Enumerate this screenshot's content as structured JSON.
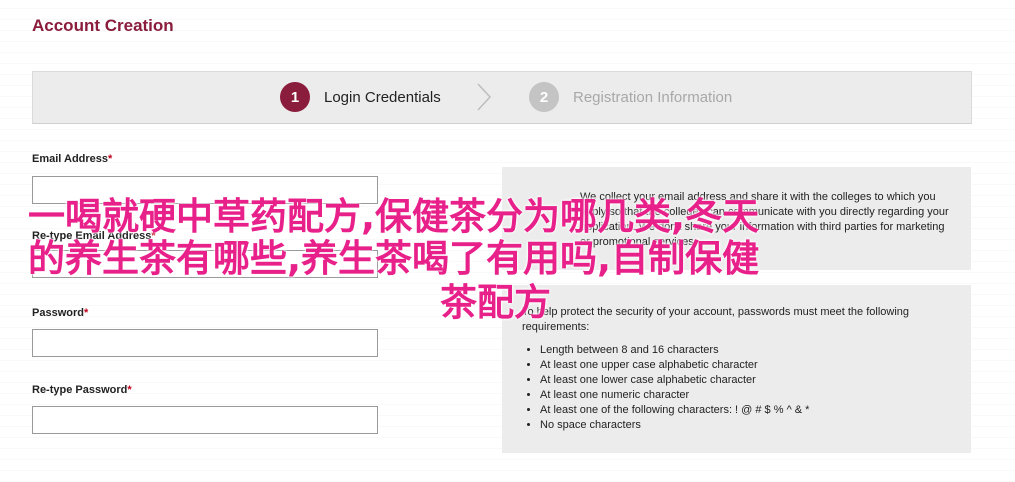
{
  "page": {
    "title": "Account Creation"
  },
  "steps": [
    {
      "number": "1",
      "label": "Login Credentials",
      "state": "active"
    },
    {
      "number": "2",
      "label": "Registration Information",
      "state": "inactive"
    }
  ],
  "form": {
    "email_label": "Email Address",
    "retype_email_label": "Re-type Email Address",
    "password_label": "Password",
    "retype_password_label": "Re-type Password",
    "required_mark": "*"
  },
  "info": {
    "email_note": "We collect your email address and share it with the colleges to which you apply so that the colleges can communicate with you directly regarding your application. We don't share your information with third parties for marketing or promotional services.",
    "password_intro": "To help protect the security of your account, passwords must meet the following requirements:",
    "password_rules": [
      "Length between 8 and 16 characters",
      "At least one upper case alphabetic character",
      "At least one lower case alphabetic character",
      "At least one numeric character",
      "At least one of the following characters: ! @ # $ % ^ & *",
      "No space characters"
    ]
  },
  "overlay": {
    "line1": "一喝就硬中草药配方,保健茶分为哪几类,冬天",
    "line2": "的养生茶有哪些,养生茶喝了有用吗,自制保健",
    "line3": "茶配方"
  },
  "colors": {
    "brand": "#8a1c3c",
    "overlay_text": "#e8208a"
  }
}
